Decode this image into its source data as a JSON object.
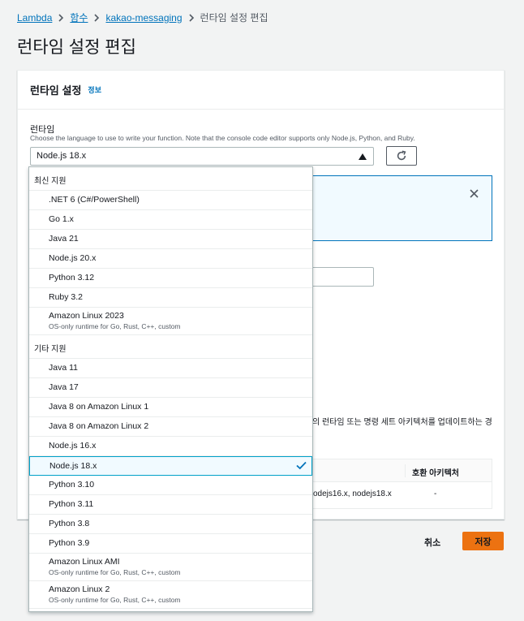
{
  "breadcrumb": {
    "lambda": "Lambda",
    "functions": "함수",
    "function_name": "kakao-messaging",
    "current": "런타임 설정 편집"
  },
  "page_title": "런타임 설정 편집",
  "panel": {
    "title": "런타임 설정",
    "info": "정보",
    "runtime_label": "런타임",
    "runtime_desc": "Choose the language to use to write your function. Note that the console code editor supports only Node.js, Python, and Ruby.",
    "runtime_value": "Node.js 18.x",
    "warning_fragment": "의 런타임 또는 명령 세트 아키텍처를 업데이트하는 경",
    "table": {
      "compat_header": "호환 아키텍처",
      "runtimes_cell": "odejs16.x, nodejs18.x",
      "arch_cell": "-"
    }
  },
  "dropdown": {
    "latest_header": "최신 지원",
    "latest": [
      {
        "label": ".NET 6 (C#/PowerShell)"
      },
      {
        "label": "Go 1.x"
      },
      {
        "label": "Java 21"
      },
      {
        "label": "Node.js 20.x"
      },
      {
        "label": "Python 3.12"
      },
      {
        "label": "Ruby 3.2"
      },
      {
        "label": "Amazon Linux 2023",
        "sub": "OS-only runtime for Go, Rust, C++, custom"
      }
    ],
    "other_header": "기타 지원",
    "other": [
      {
        "label": "Java 11"
      },
      {
        "label": "Java 17"
      },
      {
        "label": "Java 8 on Amazon Linux 1"
      },
      {
        "label": "Java 8 on Amazon Linux 2"
      },
      {
        "label": "Node.js 16.x"
      },
      {
        "label": "Node.js 18.x",
        "selected": true
      },
      {
        "label": "Python 3.10"
      },
      {
        "label": "Python 3.11"
      },
      {
        "label": "Python 3.8"
      },
      {
        "label": "Python 3.9"
      },
      {
        "label": "Amazon Linux AMI",
        "sub": "OS-only runtime for Go, Rust, C++, custom"
      },
      {
        "label": "Amazon Linux 2",
        "sub": "OS-only runtime for Go, Rust, C++, custom"
      }
    ]
  },
  "footer": {
    "cancel": "취소",
    "save": "저장"
  },
  "colors": {
    "link": "#0073bb",
    "primary_button": "#ec7211",
    "selected_border": "#00a1c9",
    "info_bg": "#f1faff"
  }
}
